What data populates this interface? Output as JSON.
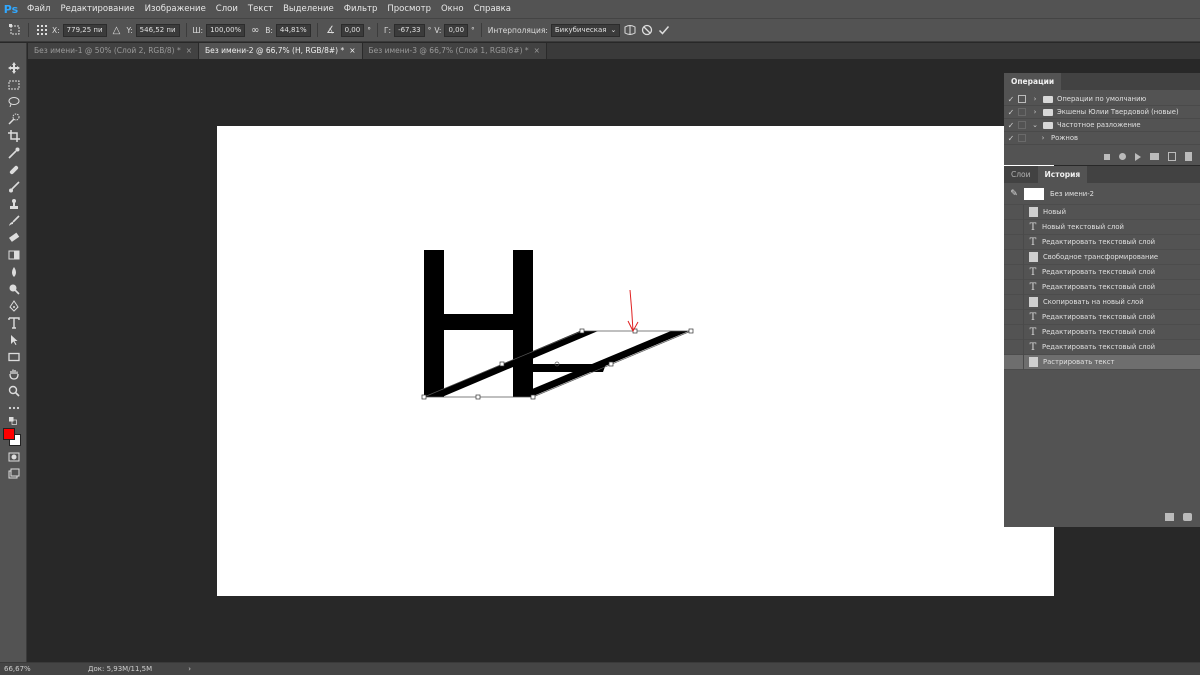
{
  "app": {
    "logo": "Ps"
  },
  "menu": [
    "Файл",
    "Редактирование",
    "Изображение",
    "Слои",
    "Текст",
    "Выделение",
    "Фильтр",
    "Просмотр",
    "Окно",
    "Справка"
  ],
  "options": {
    "x_label": "X:",
    "x_value": "779,25 пи",
    "y_label": "Y:",
    "y_value": "546,52 пи",
    "w_label": "Ш:",
    "w_value": "100,00%",
    "h_label": "В:",
    "h_value": "44,81%",
    "angle_value": "0,00",
    "deg": "°",
    "g_label": "Г:",
    "g_value": "-67,33",
    "v_label": "V:",
    "v_value": "0,00",
    "interp_label": "Интерполяция:",
    "interp_value": "Бикубическая"
  },
  "tabs": [
    {
      "label": "Без имени-1 @ 50% (Слой 2, RGB/8) *",
      "close": "×"
    },
    {
      "label": "Без имени-2 @ 66,7% (H, RGB/8#) *",
      "close": "×"
    },
    {
      "label": "Без имени-3 @ 66,7% (Слой 1, RGB/8#) *",
      "close": "×"
    }
  ],
  "canvas": {
    "letter": "H"
  },
  "status": {
    "zoom": "66,67%",
    "doc": "Док: 5,93M/11,5M"
  },
  "actions_panel": {
    "tab": "Операции",
    "rows": [
      "Операции по умолчанию",
      "Экшены Юлии Твердовой (новые)",
      "Частотное разложение",
      "Рожнов"
    ]
  },
  "history_panel": {
    "tabs": [
      "Слои",
      "История"
    ],
    "snapshot": "Без имени-2",
    "items": [
      {
        "label": "Новый",
        "icon": "doc-icon"
      },
      {
        "label": "Новый текстовый слой",
        "icon": "text-icon"
      },
      {
        "label": "Редактировать текстовый слой",
        "icon": "text-icon"
      },
      {
        "label": "Свободное трансформирование",
        "icon": "doc-icon"
      },
      {
        "label": "Редактировать текстовый слой",
        "icon": "text-icon"
      },
      {
        "label": "Редактировать текстовый слой",
        "icon": "text-icon"
      },
      {
        "label": "Скопировать на новый слой",
        "icon": "doc-icon"
      },
      {
        "label": "Редактировать текстовый слой",
        "icon": "text-icon"
      },
      {
        "label": "Редактировать текстовый слой",
        "icon": "text-icon"
      },
      {
        "label": "Редактировать текстовый слой",
        "icon": "text-icon"
      },
      {
        "label": "Растрировать текст",
        "icon": "doc-icon"
      }
    ]
  },
  "colors": {
    "foreground": "#ff0000",
    "background": "#ffffff"
  }
}
